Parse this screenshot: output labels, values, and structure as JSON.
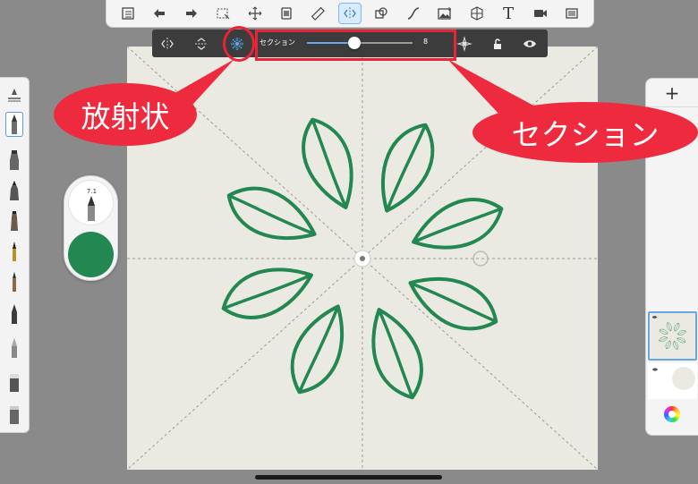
{
  "top_toolbar": {
    "buttons": [
      {
        "icon": "list-icon"
      },
      {
        "icon": "undo-icon"
      },
      {
        "icon": "redo-icon"
      },
      {
        "icon": "selection-icon"
      },
      {
        "icon": "transform-icon"
      },
      {
        "icon": "layer-ruler-icon"
      },
      {
        "icon": "ruler-icon"
      },
      {
        "icon": "symmetry-icon",
        "active": true
      },
      {
        "icon": "shapes-icon"
      },
      {
        "icon": "curve-icon"
      },
      {
        "icon": "image-icon"
      },
      {
        "icon": "perspective-icon"
      },
      {
        "icon": "text-icon",
        "text": "T"
      },
      {
        "icon": "video-icon"
      },
      {
        "icon": "fullscreen-icon"
      }
    ]
  },
  "symmetry_toolbar": {
    "section_label": "セクション",
    "section_value": "8",
    "slider_fraction": 0.45,
    "buttons": [
      "vertical-symmetry-icon",
      "horizontal-symmetry-icon",
      "radial-symmetry-icon",
      "center-target-icon",
      "lock-icon",
      "eye-icon"
    ]
  },
  "puck": {
    "brush_size": "7.1",
    "color": "#238752"
  },
  "layers": {
    "add_label": "+"
  },
  "annotations": {
    "radial_label": "放射状",
    "section_label": "セクション",
    "color": "#ee2a3e"
  },
  "colors": {
    "stroke": "#238752",
    "canvas": "#ebeae2",
    "accent": "#65a7ec"
  }
}
